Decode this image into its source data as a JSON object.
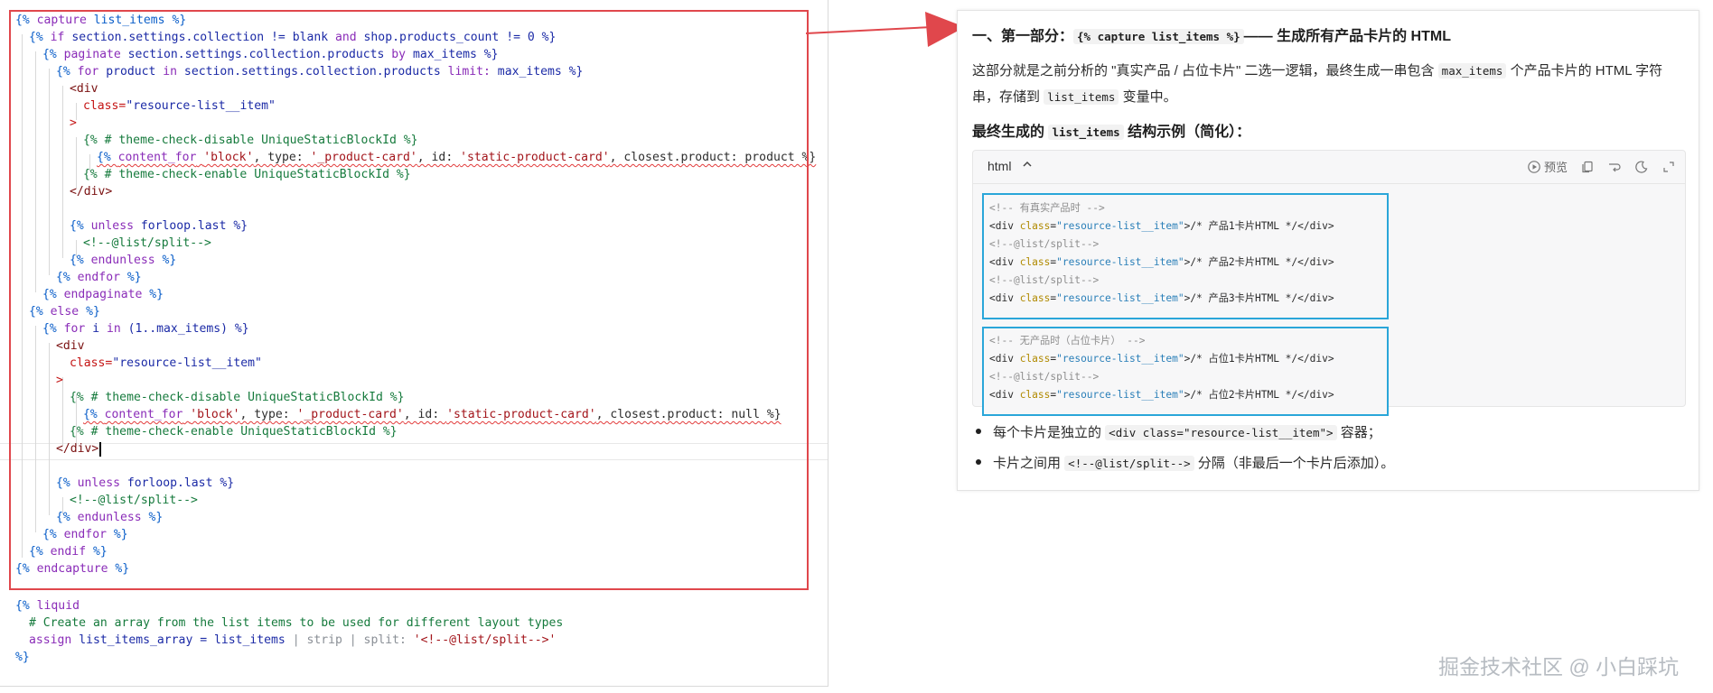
{
  "editor": {
    "code": {
      "l1": [
        "{% ",
        "capture",
        " list_items %}"
      ],
      "l2_a": "{% ",
      "l2_b": "if",
      "l2_c": " section.settings.collection != blank ",
      "l2_d": "and",
      "l2_e": " shop.products_count != 0 %}",
      "l3_a": "{% ",
      "l3_b": "paginate",
      "l3_c": " section.settings.collection.products ",
      "l3_d": "by",
      "l3_e": " max_items %}",
      "l4_a": "{% ",
      "l4_b": "for",
      "l4_c": " product ",
      "l4_d": "in",
      "l4_e": " section.settings.collection.products ",
      "l4_f": "limit:",
      "l4_g": " max_items %}",
      "l5": "<div",
      "l6_a": "class=",
      "l6_b": "\"resource-list__item\"",
      "l7": ">",
      "l8": "{% # theme-check-disable UniqueStaticBlockId %}",
      "l9_a": "{% ",
      "l9_b": "content_for",
      "l9_c": " ",
      "l9_d": "'block'",
      "l9_e": ", type: ",
      "l9_f": "'_product-card'",
      "l9_g": ", id: ",
      "l9_h": "'static-product-card'",
      "l9_i": ", closest.product: product %}",
      "l10": "{% # theme-check-enable UniqueStaticBlockId %}",
      "l11": "</div>",
      "l13_a": "{% ",
      "l13_b": "unless",
      "l13_c": " forloop.last %}",
      "l14": "<!--@list/split-->",
      "l15_a": "{% ",
      "l15_b": "endunless",
      "l15_c": " %}",
      "l16_a": "{% ",
      "l16_b": "endfor",
      "l16_c": " %}",
      "l17_a": "{% ",
      "l17_b": "endpaginate",
      "l17_c": " %}",
      "l18_a": "{% ",
      "l18_b": "else",
      "l18_c": " %}",
      "l19_a": "{% ",
      "l19_b": "for",
      "l19_c": " i ",
      "l19_d": "in",
      "l19_e": " (1..max_items) %}",
      "l20": "<div",
      "l21_a": "class=",
      "l21_b": "\"resource-list__item\"",
      "l22": ">",
      "l23": "{% # theme-check-disable UniqueStaticBlockId %}",
      "l24_a": "{% ",
      "l24_b": "content_for",
      "l24_c": " ",
      "l24_d": "'block'",
      "l24_e": ", type: ",
      "l24_f": "'_product-card'",
      "l24_g": ", id: ",
      "l24_h": "'static-product-card'",
      "l24_i": ", closest.product: null %}",
      "l25": "{% # theme-check-enable UniqueStaticBlockId %}",
      "l26": "</div>",
      "l28_a": "{% ",
      "l28_b": "unless",
      "l28_c": " forloop.last %}",
      "l29": "<!--@list/split-->",
      "l30_a": "{% ",
      "l30_b": "endunless",
      "l30_c": " %}",
      "l31_a": "{% ",
      "l31_b": "endfor",
      "l31_c": " %}",
      "l32_a": "{% ",
      "l32_b": "endif",
      "l32_c": " %}",
      "l33_a": "{% ",
      "l33_b": "endcapture",
      "l33_c": " %}",
      "l35_a": "{% ",
      "l35_b": "liquid",
      "l36": "# Create an array from the list items to be used for different layout types",
      "l37_a": "assign",
      "l37_b": " list_items_array = list_items ",
      "l37_c": "|",
      "l37_d": " strip ",
      "l37_e": "|",
      "l37_f": " split: ",
      "l37_g": "'<!--@list/split-->'",
      "l38": "%}"
    }
  },
  "panel": {
    "title_prefix": "一、第一部分：",
    "title_code": "{% capture list_items %}",
    "title_suffix": "—— 生成所有产品卡片的 HTML",
    "para_1": "这部分就是之前分析的 \"真实产品 / 占位卡片\" 二选一逻辑，最终生成一串包含 ",
    "para_code1": "max_items",
    "para_2": " 个产品卡片的 HTML 字符串，存储到 ",
    "para_code2": "list_items",
    "para_3": " 变量中。",
    "sub_prefix": "最终生成的 ",
    "sub_code": "list_items",
    "sub_suffix": " 结构示例（简化）：",
    "codeblock": {
      "lang": "html",
      "caret": "^",
      "preview_label": "预览"
    },
    "snippet1": {
      "c1": "<!-- 有真实产品时 -->",
      "div_open": "<div ",
      "attr": "class",
      "eq": "=",
      "val": "\"resource-list__item\"",
      "r1": ">/* 产品1卡片HTML */</div>",
      "split": "<!--@list/split-->",
      "r2": ">/* 产品2卡片HTML */</div>",
      "r3": ">/* 产品3卡片HTML */</div>"
    },
    "snippet2": {
      "c1": "<!-- 无产品时（占位卡片） -->",
      "r1": ">/* 占位1卡片HTML */</div>",
      "r2": ">/* 占位2卡片HTML */</div>"
    },
    "bullet1_a": "每个卡片是独立的 ",
    "bullet1_code": "<div class=\"resource-list__item\">",
    "bullet1_b": " 容器；",
    "bullet2_a": "卡片之间用 ",
    "bullet2_code": "<!--@list/split-->",
    "bullet2_b": " 分隔（非最后一个卡片后添加）。"
  },
  "watermark": "掘金技术社区 @ 小白踩坑",
  "colors": {
    "highlight_box": "#e0474c",
    "snippet_border": "#2aa6d9",
    "arrow": "#e0474c"
  }
}
